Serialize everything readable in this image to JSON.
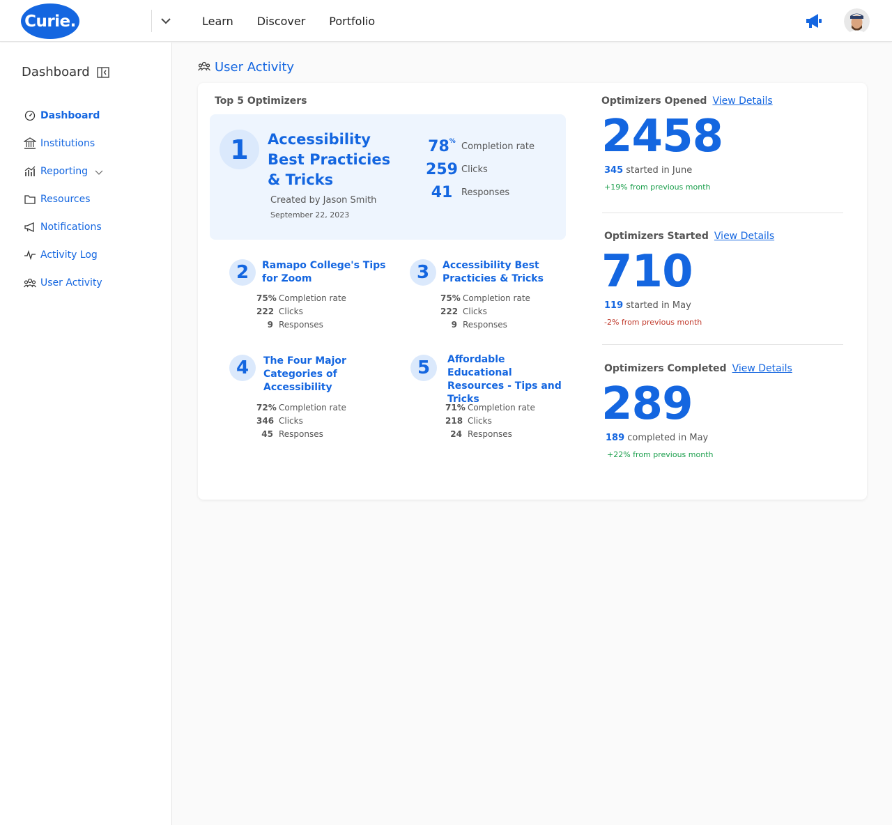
{
  "header": {
    "logo_text": "Curie.",
    "nav": [
      "Learn",
      "Discover",
      "Portfolio"
    ]
  },
  "sidebar": {
    "title": "Dashboard",
    "items": [
      {
        "label": "Dashboard",
        "icon": "dashboard-icon"
      },
      {
        "label": "Institutions",
        "icon": "institution-icon"
      },
      {
        "label": "Reporting",
        "icon": "chart-icon"
      },
      {
        "label": "Resources",
        "icon": "folder-icon"
      },
      {
        "label": "Notifications",
        "icon": "megaphone-icon"
      },
      {
        "label": "Activity Log",
        "icon": "activity-icon"
      },
      {
        "label": "User Activity",
        "icon": "users-icon"
      }
    ]
  },
  "main": {
    "section_title": "User Activity",
    "top5_title": "Top 5 Optimizers",
    "top1": {
      "rank": "1",
      "title": "Accessibility Best Practicies & Tricks",
      "creator": "Created by Jason Smith",
      "date": "September 22, 2023",
      "completion": "78",
      "completion_unit": "%",
      "completion_label": "Completion rate",
      "clicks": "259",
      "clicks_label": "Clicks",
      "responses": "41",
      "responses_label": "Responses"
    },
    "others": [
      {
        "rank": "2",
        "title": "Ramapo College's Tips for Zoom",
        "completion": "75%",
        "clicks": "222",
        "responses": "9"
      },
      {
        "rank": "3",
        "title": "Accessibility Best Practicies & Tricks",
        "completion": "75%",
        "clicks": "222",
        "responses": "9"
      },
      {
        "rank": "4",
        "title": "The Four Major Categories of Accessibility",
        "completion": "72%",
        "clicks": "346",
        "responses": "45"
      },
      {
        "rank": "5",
        "title": "Affordable Educational Resources - Tips and Tricks",
        "completion": "71%",
        "clicks": "218",
        "responses": "24"
      }
    ],
    "labels": {
      "completion": "Completion rate",
      "clicks": "Clicks",
      "responses": "Responses"
    },
    "metrics": [
      {
        "title": "Optimizers Opened",
        "link": "View Details",
        "value": "2458",
        "sub_value": "345",
        "sub_text": "started in June",
        "trend": "+19% from previous month"
      },
      {
        "title": "Optimizers Started",
        "link": "View Details",
        "value": "710",
        "sub_value": "119",
        "sub_text": "started in May",
        "trend": "-2% from previous month"
      },
      {
        "title": "Optimizers Completed",
        "link": "View Details",
        "value": "289",
        "sub_value": "189",
        "sub_text": "completed in May",
        "trend": "+22% from previous month"
      }
    ]
  }
}
